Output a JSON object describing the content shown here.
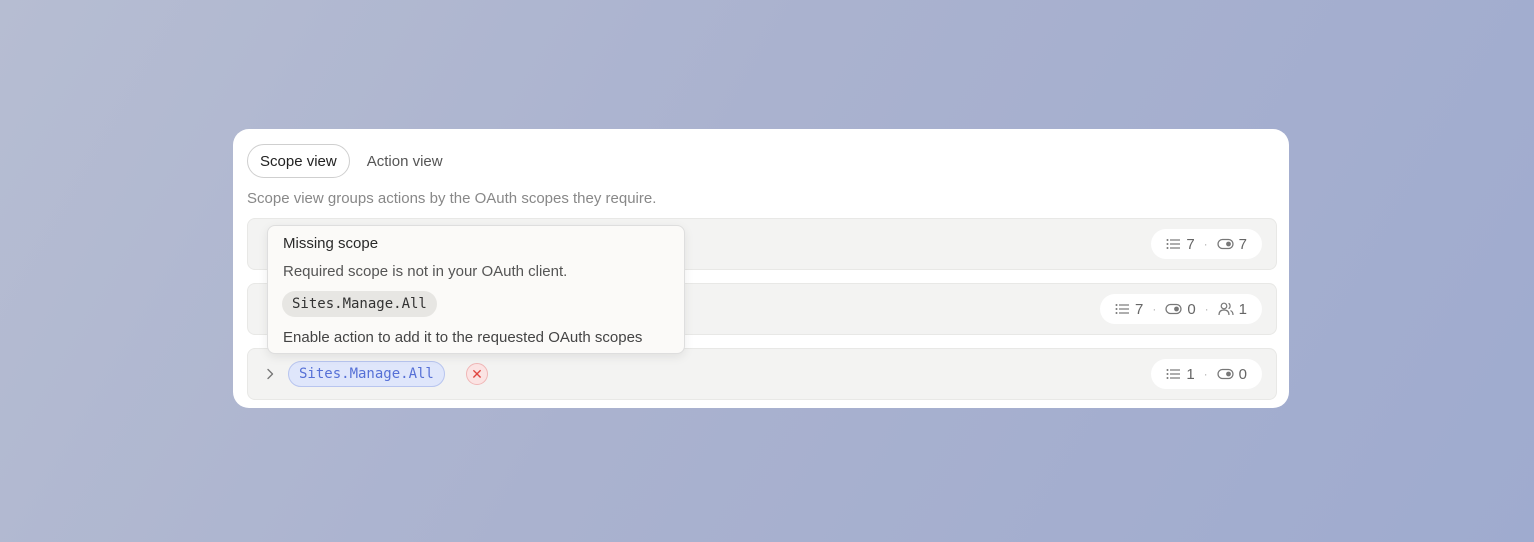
{
  "tabs": [
    {
      "label": "Scope view",
      "active": true
    },
    {
      "label": "Action view",
      "active": false
    }
  ],
  "description": "Scope view groups actions by the OAuth scopes they require.",
  "rows": [
    {
      "stats": {
        "actions": "7",
        "enabled": "7"
      }
    },
    {
      "stats": {
        "actions": "7",
        "enabled": "0",
        "users": "1"
      }
    },
    {
      "scope": "Sites.Manage.All",
      "missing": true,
      "stats": {
        "actions": "1",
        "enabled": "0"
      }
    }
  ],
  "tooltip": {
    "title": "Missing scope",
    "subtitle": "Required scope is not in your OAuth client.",
    "scope": "Sites.Manage.All",
    "action_text": "Enable action to add it to the requested OAuth scopes"
  },
  "icons": {
    "actions": "list-icon",
    "enabled": "toggle-icon",
    "users": "users-icon",
    "expand": "chevron-right-icon",
    "missing": "x-circle-icon"
  },
  "colors": {
    "scope_chip_text": "#5670d6",
    "scope_chip_bg": "#dfe6fb",
    "missing_red": "#e0453f"
  }
}
